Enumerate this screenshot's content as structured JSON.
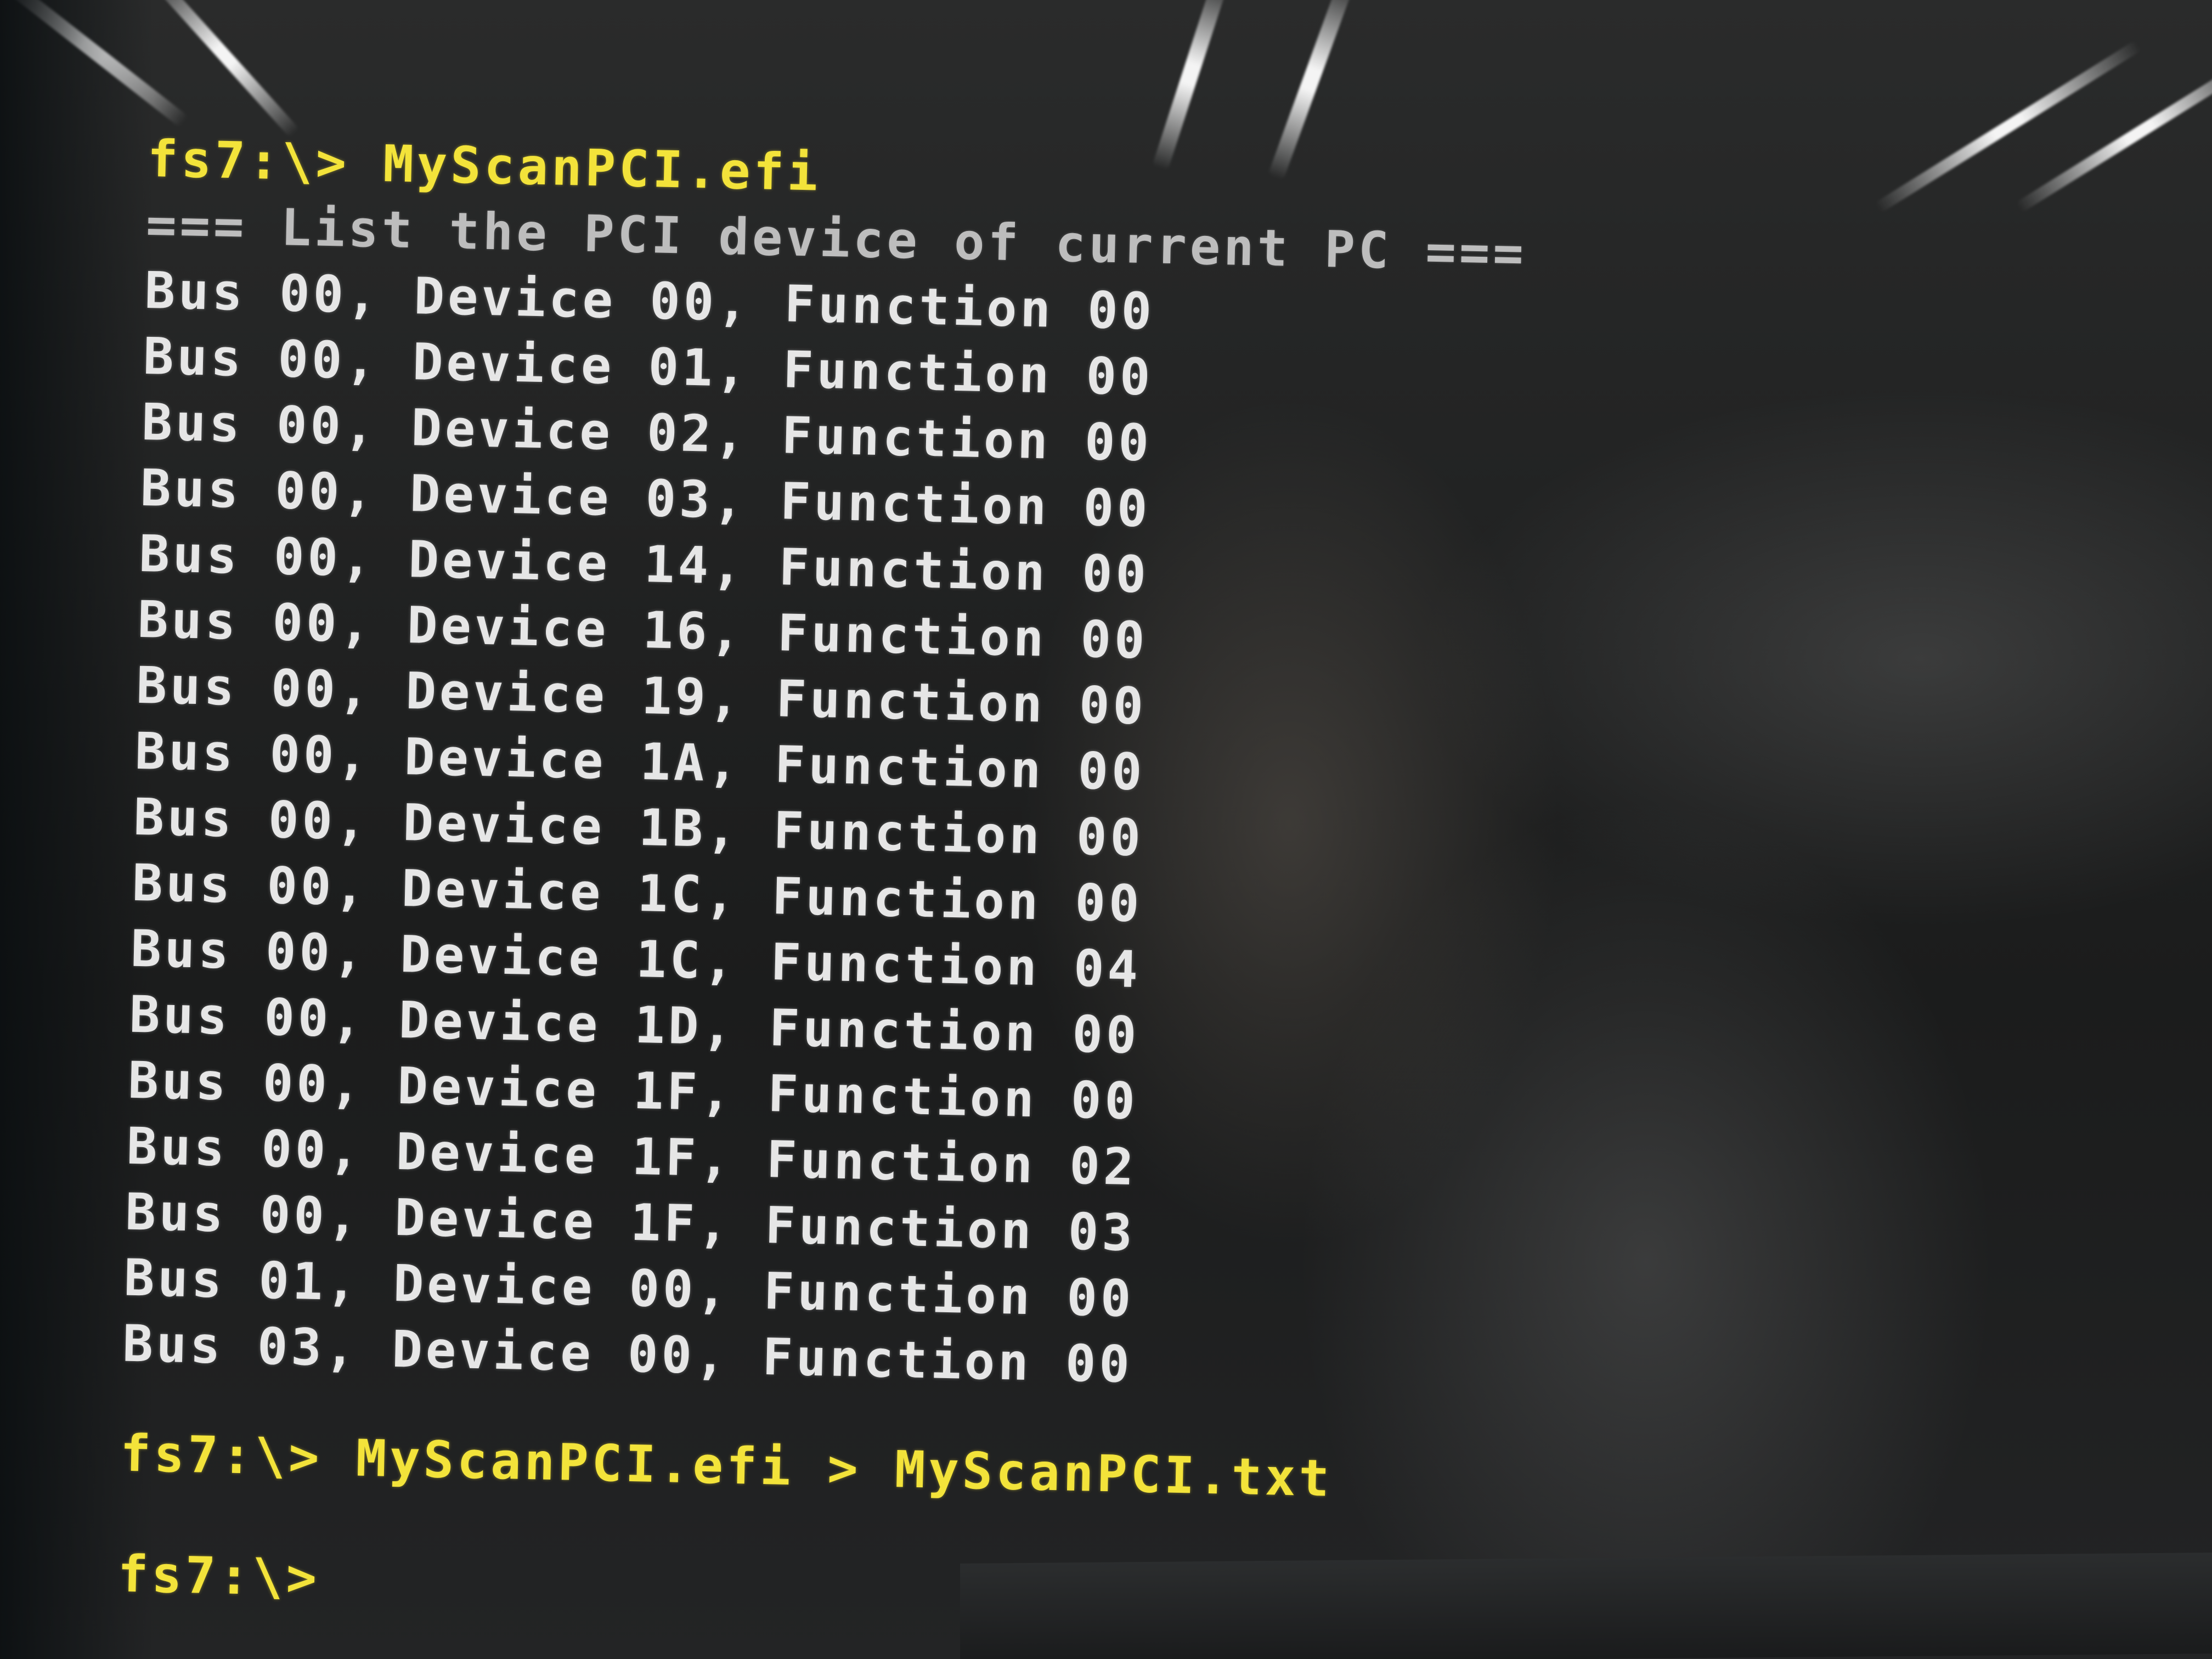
{
  "colors": {
    "prompt": "#f3e33a",
    "output": "#e6e6e6",
    "header": "#bdbdbd",
    "background": "#1e1f1f"
  },
  "terminal": {
    "command_1": {
      "prompt": "fs7:\\>",
      "command": "MyScanPCI.efi"
    },
    "header": "=== List the PCI device of current PC ===",
    "devices": [
      {
        "text": "Bus 00, Device 00, Function 00"
      },
      {
        "text": "Bus 00, Device 01, Function 00"
      },
      {
        "text": "Bus 00, Device 02, Function 00"
      },
      {
        "text": "Bus 00, Device 03, Function 00"
      },
      {
        "text": "Bus 00, Device 14, Function 00"
      },
      {
        "text": "Bus 00, Device 16, Function 00"
      },
      {
        "text": "Bus 00, Device 19, Function 00"
      },
      {
        "text": "Bus 00, Device 1A, Function 00"
      },
      {
        "text": "Bus 00, Device 1B, Function 00"
      },
      {
        "text": "Bus 00, Device 1C, Function 00"
      },
      {
        "text": "Bus 00, Device 1C, Function 04"
      },
      {
        "text": "Bus 00, Device 1D, Function 00"
      },
      {
        "text": "Bus 00, Device 1F, Function 00"
      },
      {
        "text": "Bus 00, Device 1F, Function 02"
      },
      {
        "text": "Bus 00, Device 1F, Function 03"
      },
      {
        "text": "Bus 01, Device 00, Function 00"
      },
      {
        "text": "Bus 03, Device 00, Function 00"
      }
    ],
    "command_2": {
      "prompt": "fs7:\\>",
      "command": "MyScanPCI.efi > MyScanPCI.txt"
    },
    "command_3": {
      "prompt": "fs7:\\>"
    }
  }
}
